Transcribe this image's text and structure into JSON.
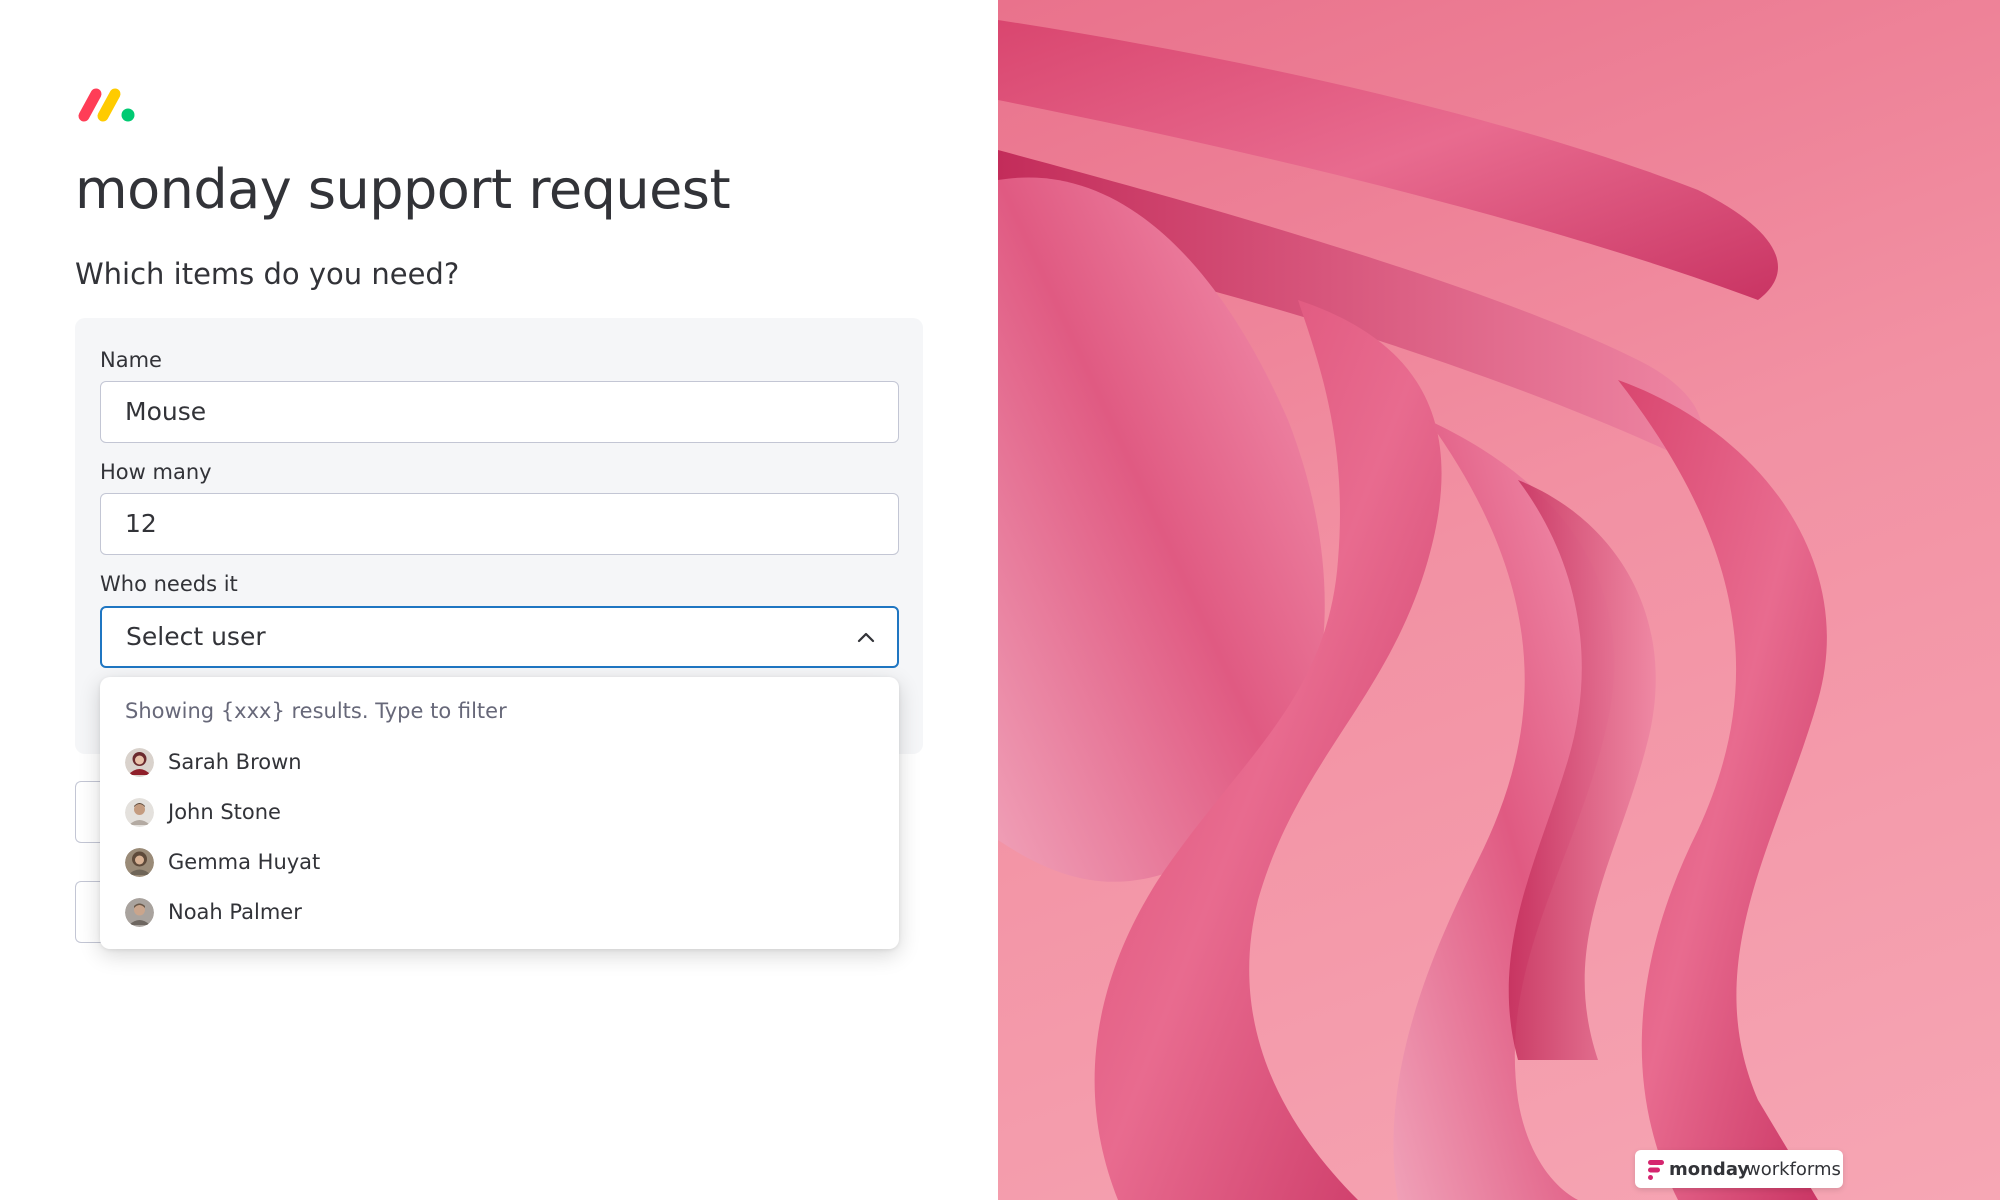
{
  "brand": {
    "logo_icon": "monday-logo-icon",
    "colors": {
      "red": "#ff3d57",
      "yellow": "#ffcb00",
      "green": "#00ca72"
    }
  },
  "form": {
    "title": "monday support request",
    "subtitle": "Which items do you need?",
    "fields": {
      "name": {
        "label": "Name",
        "value": "Mouse"
      },
      "how_many": {
        "label": "How many",
        "value": "12"
      },
      "who_needs_it": {
        "label": "Who needs it",
        "placeholder": "Select user",
        "icon": "chevron-up-icon"
      }
    }
  },
  "dropdown": {
    "hint": "Showing {xxx} results. Type to filter",
    "users": [
      {
        "name": "Sarah Brown",
        "avatar_color": "#7a3a3f"
      },
      {
        "name": "John Stone",
        "avatar_color": "#b49a86"
      },
      {
        "name": "Gemma Huyat",
        "avatar_color": "#8a7a68"
      },
      {
        "name": "Noah Palmer",
        "avatar_color": "#9a8e84"
      }
    ]
  },
  "footer_badge": {
    "icon": "workforms-logo-icon",
    "brand": "monday",
    "product": "workforms"
  },
  "accent_color": "#1f76c2"
}
